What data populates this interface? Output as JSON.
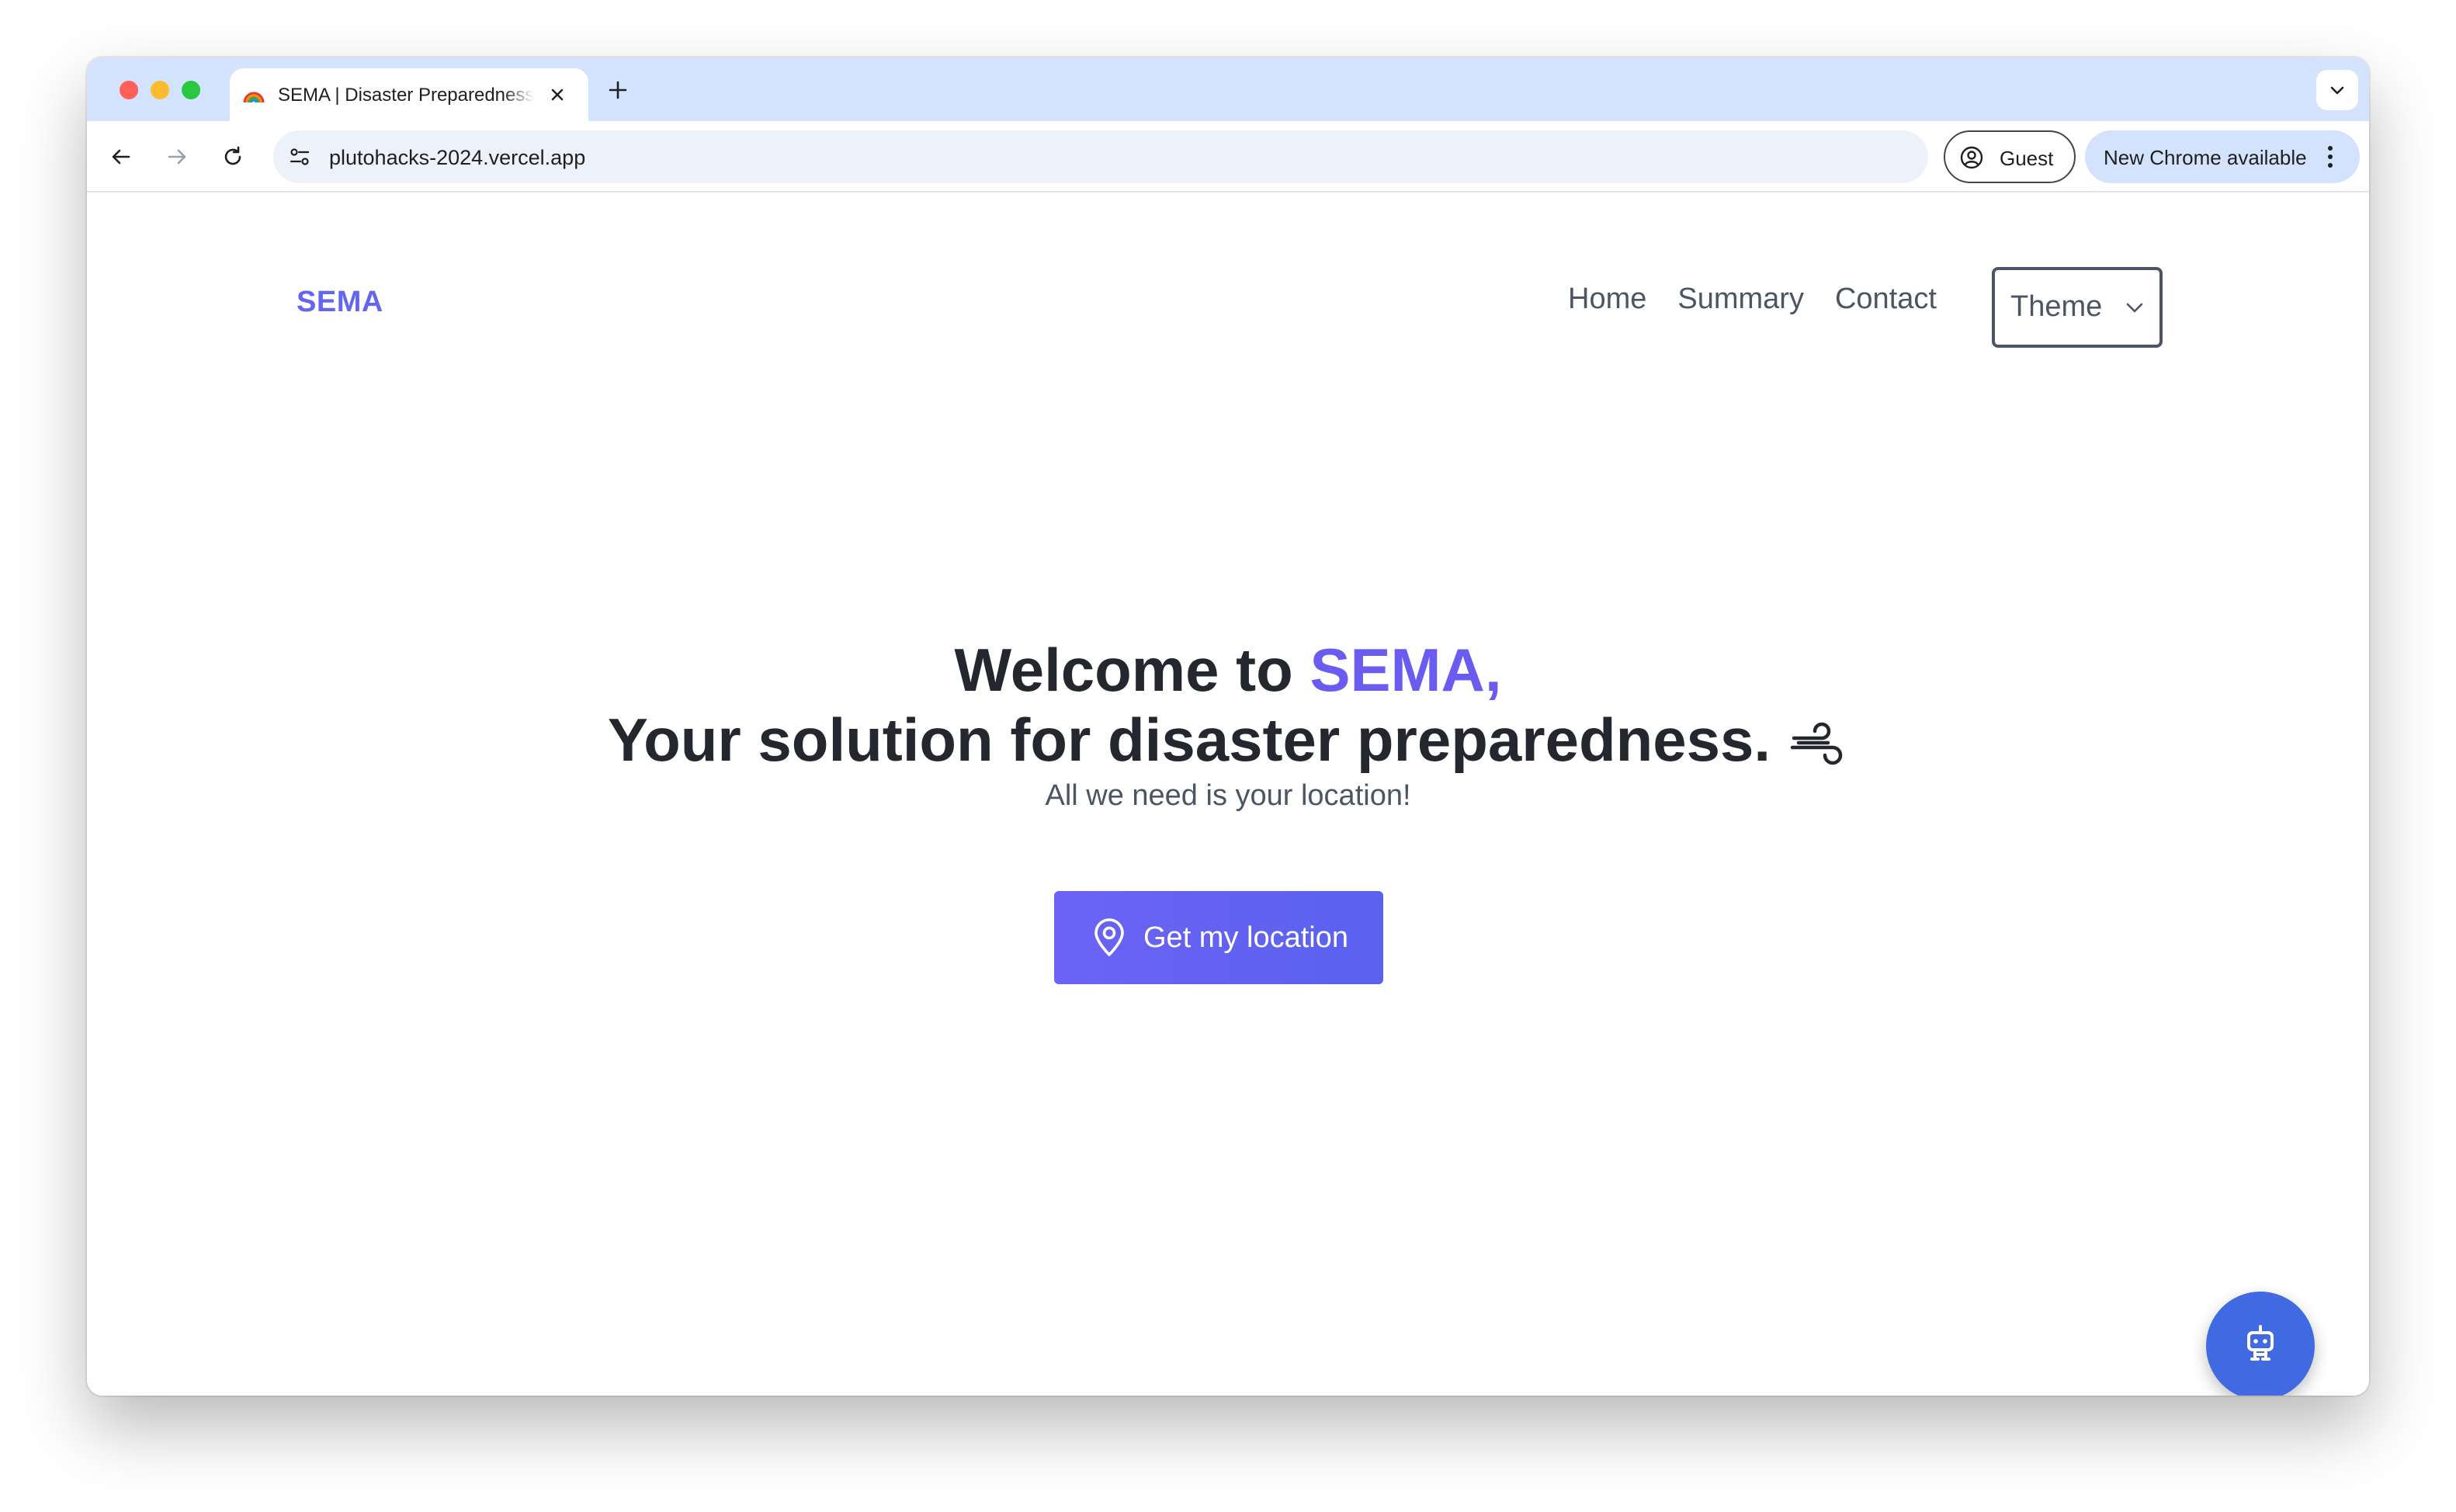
{
  "browser": {
    "tab": {
      "title": "SEMA | Disaster Preparedness",
      "favicon": "rainbow-icon"
    },
    "url": "plutohacks-2024.vercel.app",
    "profile_label": "Guest",
    "update_label": "New Chrome available"
  },
  "nav": {
    "brand": "SEMA",
    "links": [
      "Home",
      "Summary",
      "Contact"
    ],
    "theme_label": "Theme"
  },
  "hero": {
    "line1_prefix": "Welcome to ",
    "line1_accent": "SEMA,",
    "line2": "Your solution for disaster preparedness.",
    "line2_icon": "wind-icon",
    "subtitle": "All we need is your location!",
    "button_label": "Get my location",
    "button_icon": "map-pin-icon"
  },
  "fab": {
    "icon": "robot-icon"
  },
  "colors": {
    "brand": "#6366f1",
    "accent": "#6a5cf0",
    "button": "#5e63f1",
    "fab": "#4169e1",
    "tabstrip": "#d3e3fd"
  }
}
